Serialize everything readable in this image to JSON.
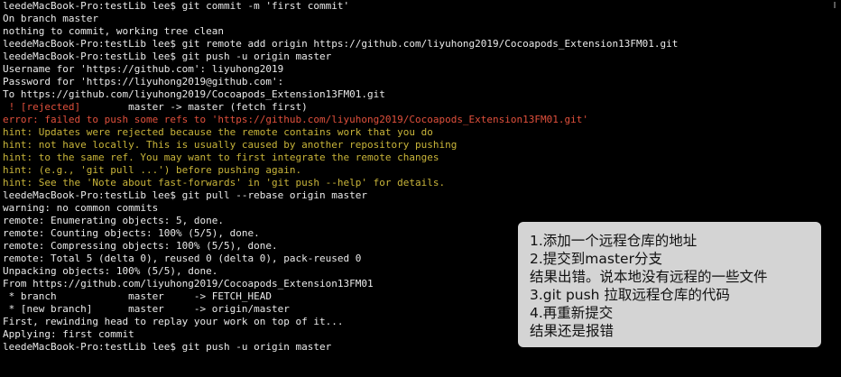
{
  "terminal": {
    "lines": [
      {
        "text": "leedeMacBook-Pro:testLib lee$ git commit -m 'first commit'",
        "color": "#eaeaea"
      },
      {
        "text": "On branch master",
        "color": "#eaeaea"
      },
      {
        "text": "nothing to commit, working tree clean",
        "color": "#eaeaea"
      },
      {
        "text": "leedeMacBook-Pro:testLib lee$ git remote add origin https://github.com/liyuhong2019/Cocoapods_Extension13FM01.git",
        "color": "#eaeaea"
      },
      {
        "text": "leedeMacBook-Pro:testLib lee$ git push -u origin master",
        "color": "#eaeaea"
      },
      {
        "text": "Username for 'https://github.com': liyuhong2019",
        "color": "#eaeaea"
      },
      {
        "text": "Password for 'https://liyuhong2019@github.com':",
        "color": "#eaeaea"
      },
      {
        "text": "To https://github.com/liyuhong2019/Cocoapods_Extension13FM01.git",
        "color": "#eaeaea"
      },
      {
        "text": " ! [rejected]",
        "text2": "        master -> master (fetch first)",
        "color": "#e0503c",
        "color2": "#eaeaea"
      },
      {
        "text": "error: failed to push some refs to 'https://github.com/liyuhong2019/Cocoapods_Extension13FM01.git'",
        "color": "#e0503c"
      },
      {
        "text": "hint: Updates were rejected because the remote contains work that you do",
        "color": "#c9b53a"
      },
      {
        "text": "hint: not have locally. This is usually caused by another repository pushing",
        "color": "#c9b53a"
      },
      {
        "text": "hint: to the same ref. You may want to first integrate the remote changes",
        "color": "#c9b53a"
      },
      {
        "text": "hint: (e.g., 'git pull ...') before pushing again.",
        "color": "#c9b53a"
      },
      {
        "text": "hint: See the 'Note about fast-forwards' in 'git push --help' for details.",
        "color": "#c9b53a"
      },
      {
        "text": "leedeMacBook-Pro:testLib lee$ git pull --rebase origin master",
        "color": "#eaeaea"
      },
      {
        "text": "warning: no common commits",
        "color": "#eaeaea"
      },
      {
        "text": "remote: Enumerating objects: 5, done.",
        "color": "#eaeaea"
      },
      {
        "text": "remote: Counting objects: 100% (5/5), done.",
        "color": "#eaeaea"
      },
      {
        "text": "remote: Compressing objects: 100% (5/5), done.",
        "color": "#eaeaea"
      },
      {
        "text": "remote: Total 5 (delta 0), reused 0 (delta 0), pack-reused 0",
        "color": "#eaeaea"
      },
      {
        "text": "Unpacking objects: 100% (5/5), done.",
        "color": "#eaeaea"
      },
      {
        "text": "From https://github.com/liyuhong2019/Cocoapods_Extension13FM01",
        "color": "#eaeaea"
      },
      {
        "text": " * branch            master     -> FETCH_HEAD",
        "color": "#eaeaea"
      },
      {
        "text": " * [new branch]      master     -> origin/master",
        "color": "#eaeaea"
      },
      {
        "text": "First, rewinding head to replay your work on top of it...",
        "color": "#eaeaea"
      },
      {
        "text": "Applying: first commit",
        "color": "#eaeaea"
      },
      {
        "text": "leedeMacBook-Pro:testLib lee$ git push -u origin master",
        "color": "#eaeaea"
      }
    ]
  },
  "note": {
    "lines": [
      "1.添加一个远程仓库的地址",
      "2.提交到master分支",
      "结果出错。说本地没有远程的一些文件",
      "3.git push 拉取远程仓库的代码",
      "4.再重新提交",
      "结果还是报错"
    ]
  }
}
